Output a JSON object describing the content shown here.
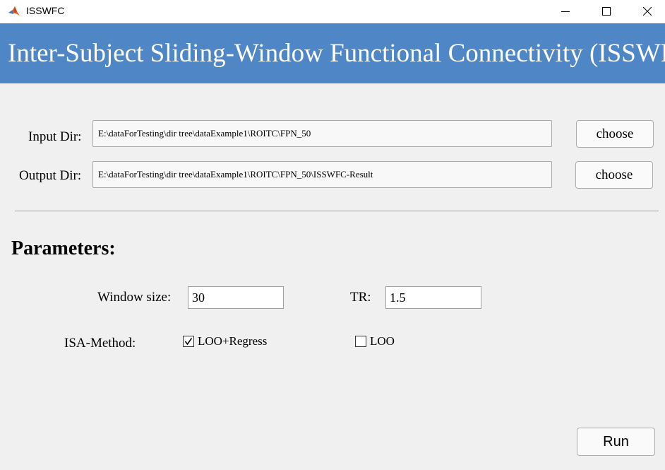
{
  "window": {
    "title": "ISSWFC",
    "icon": "matlab-icon",
    "controls": [
      "minimize-icon",
      "maximize-icon",
      "close-icon"
    ]
  },
  "banner": {
    "title": "Inter-Subject Sliding-Window Functional Connectivity (ISSWFC)",
    "color": "#4f86c6"
  },
  "input_dir": {
    "label": "Input Dir:",
    "value": "E:\\dataForTesting\\dir tree\\dataExample1\\ROITC\\FPN_50",
    "button": "choose"
  },
  "output_dir": {
    "label": "Output Dir:",
    "value": "E:\\dataForTesting\\dir tree\\dataExample1\\ROITC\\FPN_50\\ISSWFC-Result",
    "button": "choose"
  },
  "parameters": {
    "title": "Parameters:",
    "window_size": {
      "label": "Window size:",
      "value": "30"
    },
    "tr": {
      "label": "TR:",
      "value": "1.5"
    },
    "isa_method": {
      "label": "ISA-Method:",
      "options": [
        {
          "label": "LOO+Regress",
          "checked": true
        },
        {
          "label": "LOO",
          "checked": false
        }
      ]
    }
  },
  "run_button": "Run"
}
